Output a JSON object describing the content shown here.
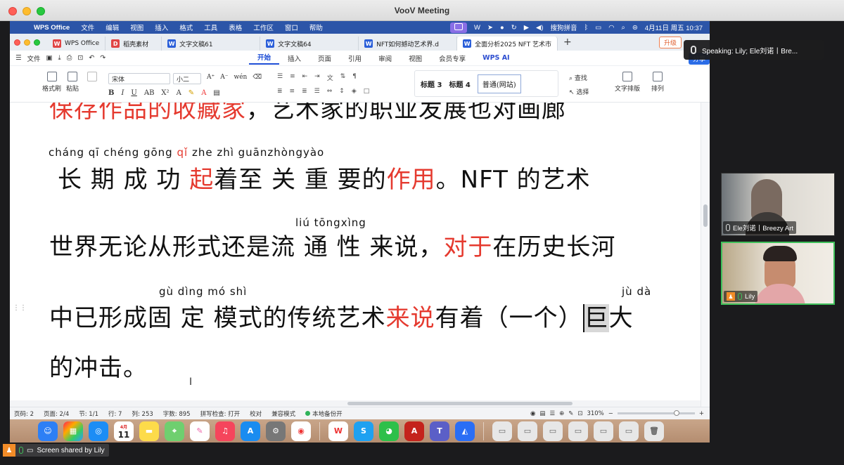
{
  "window": {
    "title": "VooV Meeting"
  },
  "menubar": {
    "app": "WPS Office",
    "items": [
      "文件",
      "编辑",
      "视图",
      "插入",
      "格式",
      "工具",
      "表格",
      "工作区",
      "窗口",
      "帮助"
    ],
    "ime": "搜狗拼音",
    "datetime": "4月11日 周五 10:37"
  },
  "tabs": [
    {
      "label": "WPS Office",
      "icon": "wps-logo-icon"
    },
    {
      "label": "稻壳素材",
      "icon": "docer-icon"
    },
    {
      "label": "文字文稿61",
      "icon": "word-doc-icon"
    },
    {
      "label": "文字文稿64",
      "icon": "word-doc-icon"
    },
    {
      "label": "NFT如何撼动艺术界.d",
      "icon": "word-doc-icon"
    },
    {
      "label": "全面分析2025 NFT 艺术市",
      "icon": "word-doc-icon"
    }
  ],
  "upgrade_label": "升级",
  "ribbon": {
    "file": "文件",
    "tabs": [
      "开始",
      "插入",
      "页面",
      "引用",
      "审阅",
      "视图",
      "会员专享"
    ],
    "active": "开始",
    "wps_ai": "WPS AI",
    "share": "分享"
  },
  "toolbar": {
    "format_painter": "格式刷",
    "paste": "粘贴",
    "font": "宋体",
    "size": "小二",
    "styles": [
      "标题 3",
      "标题 4",
      "普通(网站)"
    ],
    "find": "查找",
    "select": "选择",
    "text_layout": "文字排版",
    "arrange": "排列"
  },
  "document": {
    "line0": [
      {
        "t": "保存作品的",
        "red": true
      },
      {
        "t": "收藏家",
        "red": true
      },
      {
        "t": "，艺术家的职业发展也对画廊",
        "red": false
      }
    ],
    "pinyin1": [
      {
        "t": "cháng qī chéng gōng ",
        "red": false
      },
      {
        "t": "qǐ",
        "red": true
      },
      {
        "t": " zhe zhì guānzhòngyào",
        "red": false
      }
    ],
    "line1": [
      {
        "t": "长 期 成  功 ",
        "red": false
      },
      {
        "t": "起",
        "red": true
      },
      {
        "t": "着至 关  重 要的",
        "red": false
      },
      {
        "t": "作用",
        "red": true
      },
      {
        "t": "。NFT 的艺术",
        "red": false
      }
    ],
    "pinyin2": "liú tōngxìng",
    "line2": [
      {
        "t": "世界无论从形式还是流 通  性 来说，",
        "red": false
      },
      {
        "t": "对于",
        "red": true
      },
      {
        "t": "在历史长河",
        "red": false
      }
    ],
    "pinyin3a": "gù dìng mó shì",
    "pinyin3b": "jù  dà",
    "line3": [
      {
        "t": "中已形成固 定 模式的传统艺术",
        "red": false
      },
      {
        "t": "来说",
        "red": true
      },
      {
        "t": "有着（一个）",
        "red": false
      }
    ],
    "line3_cursor": "巨",
    "line3_end": "大",
    "line4": "的冲击。"
  },
  "status": {
    "page": "页码: 2",
    "pages": "页面: 2/4",
    "section": "节: 1/1",
    "row": "行: 7",
    "col": "列: 253",
    "words": "字数: 895",
    "spell": "拼写检查: 打开",
    "proof": "校对",
    "compat": "兼容模式",
    "backup": "本地备份开",
    "zoom": "310%"
  },
  "dock": {
    "calendar_month": "4月",
    "calendar_day": "11"
  },
  "meeting": {
    "speaking": "Speaking:  Lily; Ele刘诺丨Bre...",
    "participants": [
      {
        "name": "Ele刘诺丨Breezy Art"
      },
      {
        "name": "Lily"
      }
    ],
    "screen_shared": "Screen shared by Lily"
  }
}
